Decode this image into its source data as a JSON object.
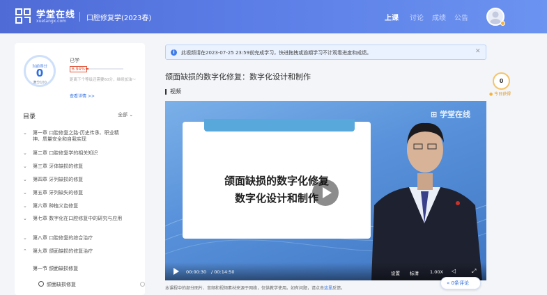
{
  "header": {
    "logo_main": "学堂在线",
    "logo_sub": "xuetangx.com",
    "course_title": "口腔修复学(2023春)",
    "nav": [
      "上课",
      "讨论",
      "成绩",
      "公告"
    ]
  },
  "score": {
    "current_label": "当前得分",
    "current_value": "0",
    "full_label": "满分100",
    "learned_label": "已学",
    "percent": "6.94%",
    "progress_fraction": 0.0694,
    "note": "距离下个等级还需要60分，继续加油～",
    "detail_link": "查看详情 >>"
  },
  "toc": {
    "title": "目录",
    "filter": "全部",
    "chapters": [
      {
        "chev": "⌄",
        "title": "第一章 口腔修复之路-历史传承、职业精神、质量安全和自我实现"
      },
      {
        "chev": "⌄",
        "title": "第二章 口腔修复学的相关知识"
      },
      {
        "chev": "⌄",
        "title": "第三章 牙体缺损的修复"
      },
      {
        "chev": "⌄",
        "title": "第四章 牙列缺损的修复"
      },
      {
        "chev": "⌄",
        "title": "第五章 牙列缺失的修复"
      },
      {
        "chev": "⌄",
        "title": "第六章 种植义齿修复"
      },
      {
        "chev": "⌄",
        "title": "第七章 数字化在口腔修复中的研究与应用"
      },
      {
        "chev": "⌄",
        "title": "第八章 口腔修复的综合治疗"
      },
      {
        "chev": "⌃",
        "title": "第九章 颌面缺损的修复治疗"
      }
    ],
    "section": "第一节 颌面缺损修复",
    "lesson": "颌面缺损修复"
  },
  "notice": {
    "icon": "info-icon",
    "text": "此视频请在2023-07-25 23:59前完成学习，快进拖拽或逾期学习不计观看进度和成绩。"
  },
  "lesson": {
    "title": "颌面缺损的数字化修复：数字化设计和制作",
    "section_label": "视频"
  },
  "today": {
    "value": "0",
    "label": "今日获得"
  },
  "video": {
    "board_line1": "颌面缺损的数字化修复",
    "board_line2": "数字化设计和制作",
    "watermark": "学堂在线",
    "current_time": "00:00:30",
    "total_time": "/ 00:14:50",
    "settings": "设置",
    "quality": "标清",
    "speed": "1.00X"
  },
  "footer": {
    "note_prefix": "本课程中的部分图片、音频和视频素材来源于网络，仅供教学使用。如有问题，请点击",
    "note_link": "这里",
    "note_suffix": "反馈。",
    "comments": "0条评论"
  },
  "colors": {
    "header_start": "#4f6bd6",
    "accent_blue": "#2e6ee0",
    "warning_red": "#e0553a",
    "coin_gold": "#f5c46a"
  }
}
